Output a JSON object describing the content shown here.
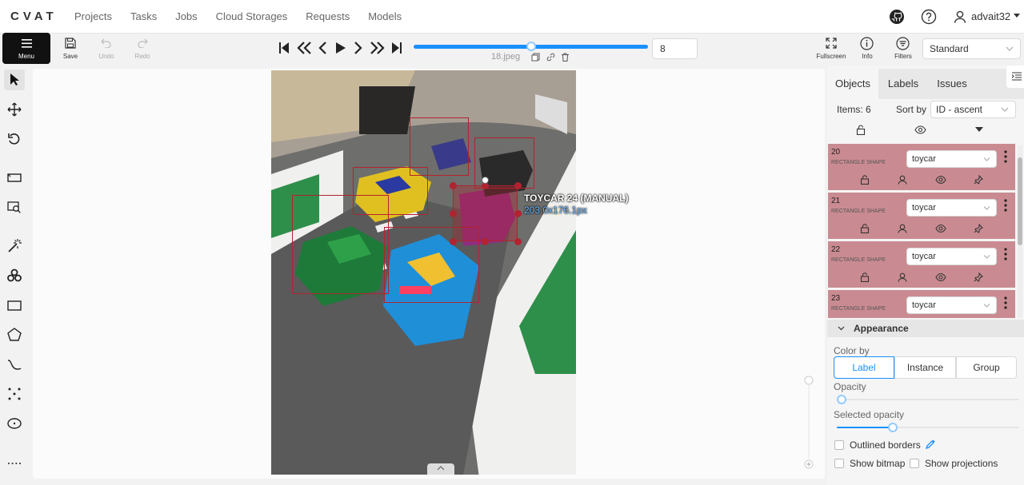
{
  "header": {
    "logo": "CVAT",
    "nav": [
      "Projects",
      "Tasks",
      "Jobs",
      "Cloud Storages",
      "Requests",
      "Models"
    ],
    "username": "advait32"
  },
  "toolbar": {
    "menu_label": "Menu",
    "save_label": "Save",
    "undo_label": "Undo",
    "redo_label": "Redo",
    "frame_number": "8",
    "filename": "18.jpeg",
    "fullscreen_label": "Fullscreen",
    "info_label": "Info",
    "filters_label": "Filters",
    "view_mode": "Standard",
    "frame_progress": 0.5
  },
  "canvas": {
    "selected_label": "TOYCAR 24 (MANUAL)",
    "selected_size": "203.0x176.1px"
  },
  "sidebar": {
    "tabs": [
      "Objects",
      "Labels",
      "Issues"
    ],
    "items_count": "Items: 6",
    "sort_label": "Sort by",
    "sort_value": "ID - ascent",
    "objects": [
      {
        "id": "20",
        "type": "RECTANGLE SHAPE",
        "label": "toycar"
      },
      {
        "id": "21",
        "type": "RECTANGLE SHAPE",
        "label": "toycar"
      },
      {
        "id": "22",
        "type": "RECTANGLE SHAPE",
        "label": "toycar"
      },
      {
        "id": "23",
        "type": "RECTANGLE SHAPE",
        "label": "toycar"
      }
    ],
    "appearance": {
      "title": "Appearance",
      "color_by_label": "Color by",
      "color_options": [
        "Label",
        "Instance",
        "Group"
      ],
      "opacity_label": "Opacity",
      "selected_opacity_label": "Selected opacity",
      "outlined_borders": "Outlined borders",
      "show_bitmap": "Show bitmap",
      "show_projections": "Show projections"
    }
  },
  "colors": {
    "accent": "#1890ff",
    "box": "#b2232f",
    "object_card": "#c98b91"
  }
}
